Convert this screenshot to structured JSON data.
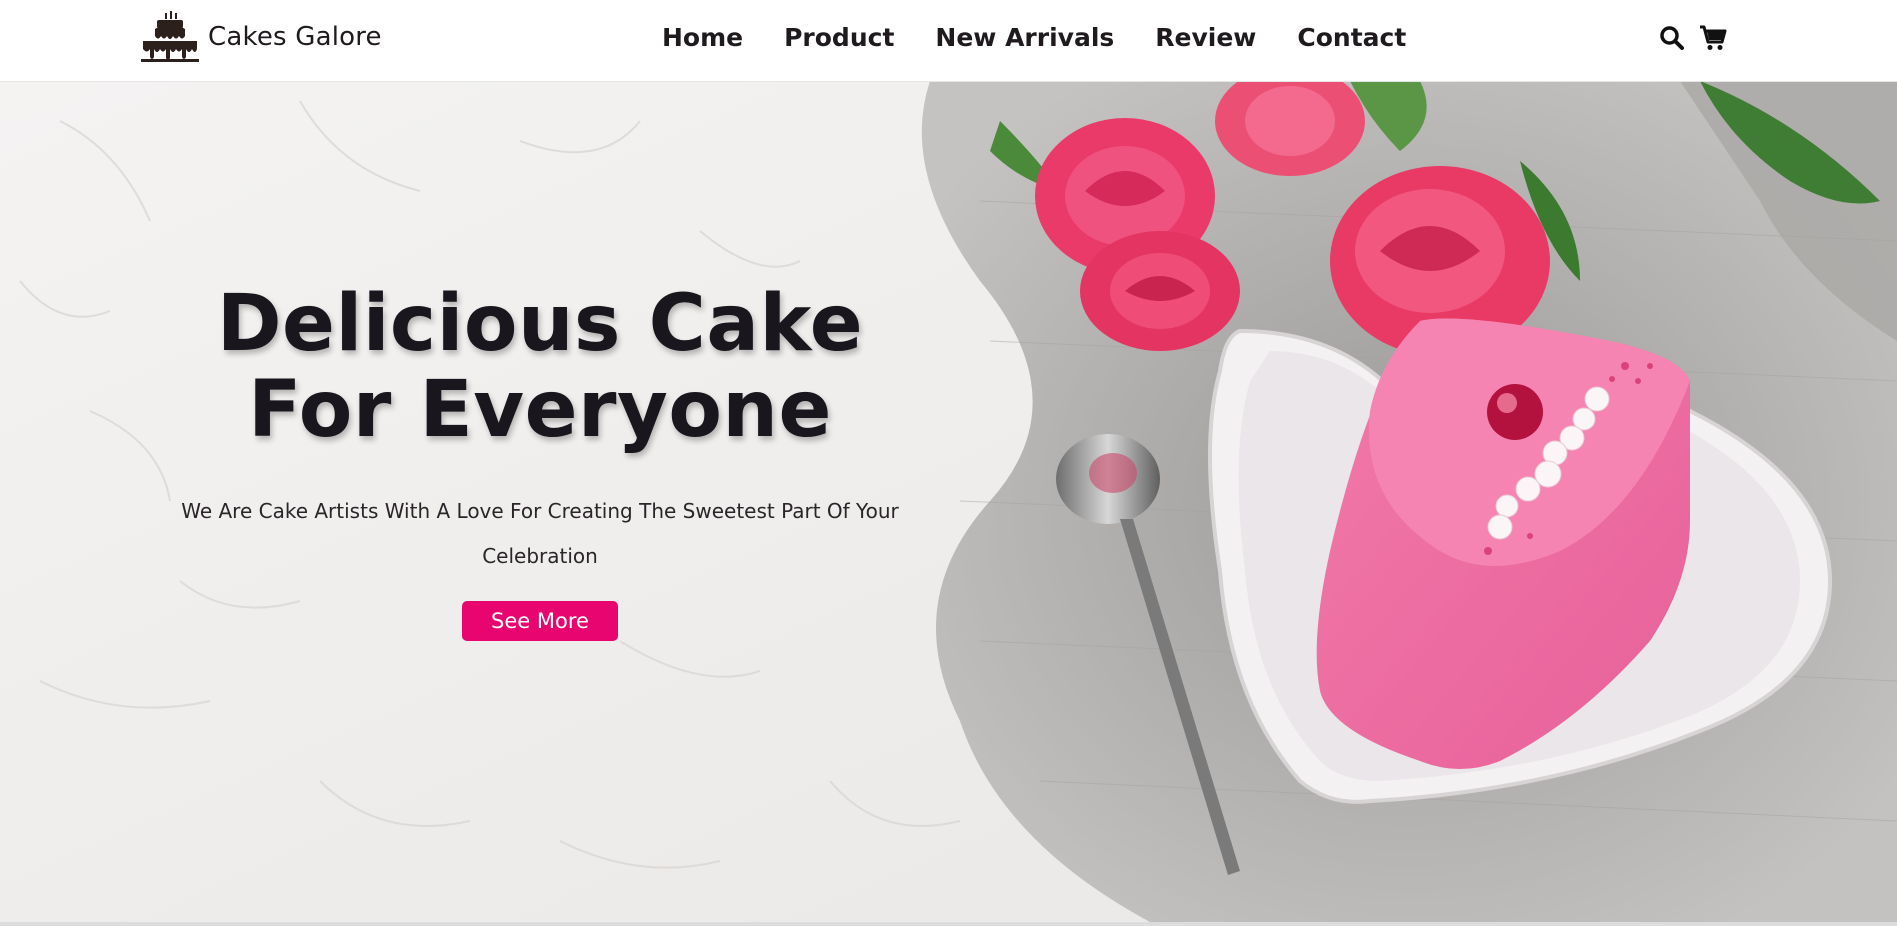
{
  "brand": {
    "name": "Cakes Galore",
    "logo_icon": "cake-icon"
  },
  "nav": {
    "items": [
      "Home",
      "Product",
      "New Arrivals",
      "Review",
      "Contact"
    ]
  },
  "header_icons": {
    "search": "search-icon",
    "cart": "cart-icon"
  },
  "hero": {
    "title_line1": "Delicious Cake",
    "title_line2": "For Everyone",
    "subtitle": "We Are Cake Artists With A Love For Creating The Sweetest Part Of Your Celebration",
    "cta_label": "See More",
    "image": "pink-cake-slice-with-roses-photo"
  },
  "colors": {
    "accent": "#e8056f",
    "text": "#1f1a1e",
    "background": "#efedeb"
  }
}
